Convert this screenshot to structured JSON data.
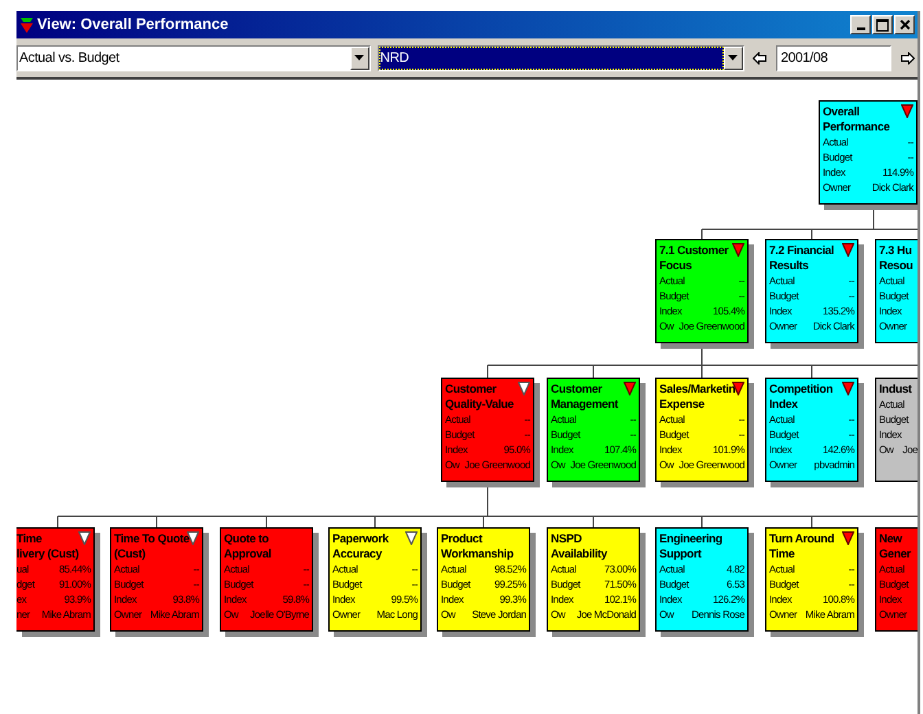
{
  "window": {
    "title": "View: Overall Performance"
  },
  "toolbar": {
    "view_select": {
      "value": "Actual vs. Budget"
    },
    "unit_select": {
      "value": "NRD",
      "selected": true
    },
    "period_field": {
      "value": "2001/08"
    }
  },
  "diagram": {
    "root": {
      "title": [
        "Overall",
        "Performance"
      ],
      "color": "#00ffff",
      "alert": true,
      "rows": [
        {
          "label": "Actual",
          "value": "--"
        },
        {
          "label": "Budget",
          "value": "--"
        },
        {
          "label": "Index",
          "value": "114.9%"
        },
        {
          "label": "Owner",
          "value": "Dick Clark"
        }
      ],
      "children": [
        {
          "title": [
            "7.1 Customer",
            "Focus"
          ],
          "color": "#00ff00",
          "alert": true,
          "rows": [
            {
              "label": "Actual",
              "value": "--"
            },
            {
              "label": "Budget",
              "value": "--"
            },
            {
              "label": "Index",
              "value": "105.4%"
            },
            {
              "label": "Ow",
              "value": "Joe Greenwood"
            }
          ],
          "children": [
            {
              "title": [
                "Customer",
                "Quality-Value"
              ],
              "color": "#ff0000",
              "alert": false,
              "rows": [
                {
                  "label": "Actual",
                  "value": "--"
                },
                {
                  "label": "Budget",
                  "value": "--"
                },
                {
                  "label": "Index",
                  "value": "95.0%"
                },
                {
                  "label": "Ow",
                  "value": "Joe Greenwood"
                }
              ],
              "children": [
                {
                  "title": [
                    "Time",
                    "livery (Cust)"
                  ],
                  "color": "#ff0000",
                  "alert": false,
                  "rows": [
                    {
                      "label": "ual",
                      "value": "85.44%"
                    },
                    {
                      "label": "dget",
                      "value": "91.00%"
                    },
                    {
                      "label": "ex",
                      "value": "93.9%"
                    },
                    {
                      "label": "ner",
                      "value": "Mike Abram"
                    }
                  ]
                },
                {
                  "title": [
                    "Time To Quote",
                    "(Cust)"
                  ],
                  "color": "#ff0000",
                  "alert": false,
                  "rows": [
                    {
                      "label": "Actual",
                      "value": "--"
                    },
                    {
                      "label": "Budget",
                      "value": "--"
                    },
                    {
                      "label": "Index",
                      "value": "93.8%"
                    },
                    {
                      "label": "Owner",
                      "value": "Mike Abram"
                    }
                  ]
                },
                {
                  "title": [
                    "Quote to",
                    "Approval"
                  ],
                  "color": "#ff0000",
                  "rows": [
                    {
                      "label": "Actual",
                      "value": "--"
                    },
                    {
                      "label": "Budget",
                      "value": "--"
                    },
                    {
                      "label": "Index",
                      "value": "59.8%"
                    },
                    {
                      "label": "Ow",
                      "value": "Joelle O'Byrne"
                    }
                  ]
                },
                {
                  "title": [
                    "Paperwork",
                    "Accuracy"
                  ],
                  "color": "#ffff00",
                  "alert": false,
                  "rows": [
                    {
                      "label": "Actual",
                      "value": "--"
                    },
                    {
                      "label": "Budget",
                      "value": "--"
                    },
                    {
                      "label": "Index",
                      "value": "99.5%"
                    },
                    {
                      "label": "Owner",
                      "value": "Mac Long"
                    }
                  ]
                },
                {
                  "title": [
                    "Product",
                    "Workmanship"
                  ],
                  "color": "#ffff00",
                  "rows": [
                    {
                      "label": "Actual",
                      "value": "98.52%"
                    },
                    {
                      "label": "Budget",
                      "value": "99.25%"
                    },
                    {
                      "label": "Index",
                      "value": "99.3%"
                    },
                    {
                      "label": "Ow",
                      "value": "Steve Jordan"
                    }
                  ]
                },
                {
                  "title": [
                    "NSPD",
                    "Availability"
                  ],
                  "color": "#ffff00",
                  "rows": [
                    {
                      "label": "Actual",
                      "value": "73.00%"
                    },
                    {
                      "label": "Budget",
                      "value": "71.50%"
                    },
                    {
                      "label": "Index",
                      "value": "102.1%"
                    },
                    {
                      "label": "Ow",
                      "value": "Joe McDonald"
                    }
                  ]
                },
                {
                  "title": [
                    "Engineering",
                    "Support"
                  ],
                  "color": "#00ffff",
                  "rows": [
                    {
                      "label": "Actual",
                      "value": "4.82"
                    },
                    {
                      "label": "Budget",
                      "value": "6.53"
                    },
                    {
                      "label": "Index",
                      "value": "126.2%"
                    },
                    {
                      "label": "Ow",
                      "value": "Dennis Rose"
                    }
                  ]
                },
                {
                  "title": [
                    "Turn Around",
                    "Time"
                  ],
                  "color": "#ffff00",
                  "alert": true,
                  "rows": [
                    {
                      "label": "Actual",
                      "value": "--"
                    },
                    {
                      "label": "Budget",
                      "value": "--"
                    },
                    {
                      "label": "Index",
                      "value": "100.8%"
                    },
                    {
                      "label": "Owner",
                      "value": "Mike Abram"
                    }
                  ]
                },
                {
                  "title": [
                    "New",
                    "Gener"
                  ],
                  "color": "#ff0000",
                  "rows": [
                    {
                      "label": "Actual"
                    },
                    {
                      "label": "Budget"
                    },
                    {
                      "label": "Index"
                    },
                    {
                      "label": "Owner"
                    }
                  ]
                }
              ]
            },
            {
              "title": [
                "Customer",
                "Management"
              ],
              "color": "#00ff00",
              "alert": true,
              "rows": [
                {
                  "label": "Actual",
                  "value": "--"
                },
                {
                  "label": "Budget",
                  "value": "--"
                },
                {
                  "label": "Index",
                  "value": "107.4%"
                },
                {
                  "label": "Ow",
                  "value": "Joe Greenwood"
                }
              ]
            },
            {
              "title": [
                "Sales/Marketin",
                "Expense"
              ],
              "color": "#ffff00",
              "alert": true,
              "rows": [
                {
                  "label": "Actual",
                  "value": "--"
                },
                {
                  "label": "Budget",
                  "value": "--"
                },
                {
                  "label": "Index",
                  "value": "101.9%"
                },
                {
                  "label": "Ow",
                  "value": "Joe Greenwood"
                }
              ]
            },
            {
              "title": [
                "Competition",
                "Index"
              ],
              "color": "#00ffff",
              "alert": true,
              "rows": [
                {
                  "label": "Actual",
                  "value": "--"
                },
                {
                  "label": "Budget",
                  "value": "--"
                },
                {
                  "label": "Index",
                  "value": "142.6%"
                },
                {
                  "label": "Owner",
                  "value": "pbvadmin"
                }
              ]
            },
            {
              "title": [
                "Indust"
              ],
              "color": "#c0c0c0",
              "rows": [
                {
                  "label": "Actual"
                },
                {
                  "label": "Budget"
                },
                {
                  "label": "Index"
                },
                {
                  "label": "Ow",
                  "value": "Joe"
                }
              ]
            }
          ]
        },
        {
          "title": [
            "7.2 Financial",
            "Results"
          ],
          "color": "#00ffff",
          "alert": true,
          "rows": [
            {
              "label": "Actual",
              "value": "--"
            },
            {
              "label": "Budget",
              "value": "--"
            },
            {
              "label": "Index",
              "value": "135.2%"
            },
            {
              "label": "Owner",
              "value": "Dick Clark"
            }
          ]
        },
        {
          "title": [
            "7.3 Hu",
            "Resou"
          ],
          "color": "#00ffff",
          "rows": [
            {
              "label": "Actual"
            },
            {
              "label": "Budget"
            },
            {
              "label": "Index"
            },
            {
              "label": "Owner"
            }
          ]
        }
      ]
    }
  }
}
